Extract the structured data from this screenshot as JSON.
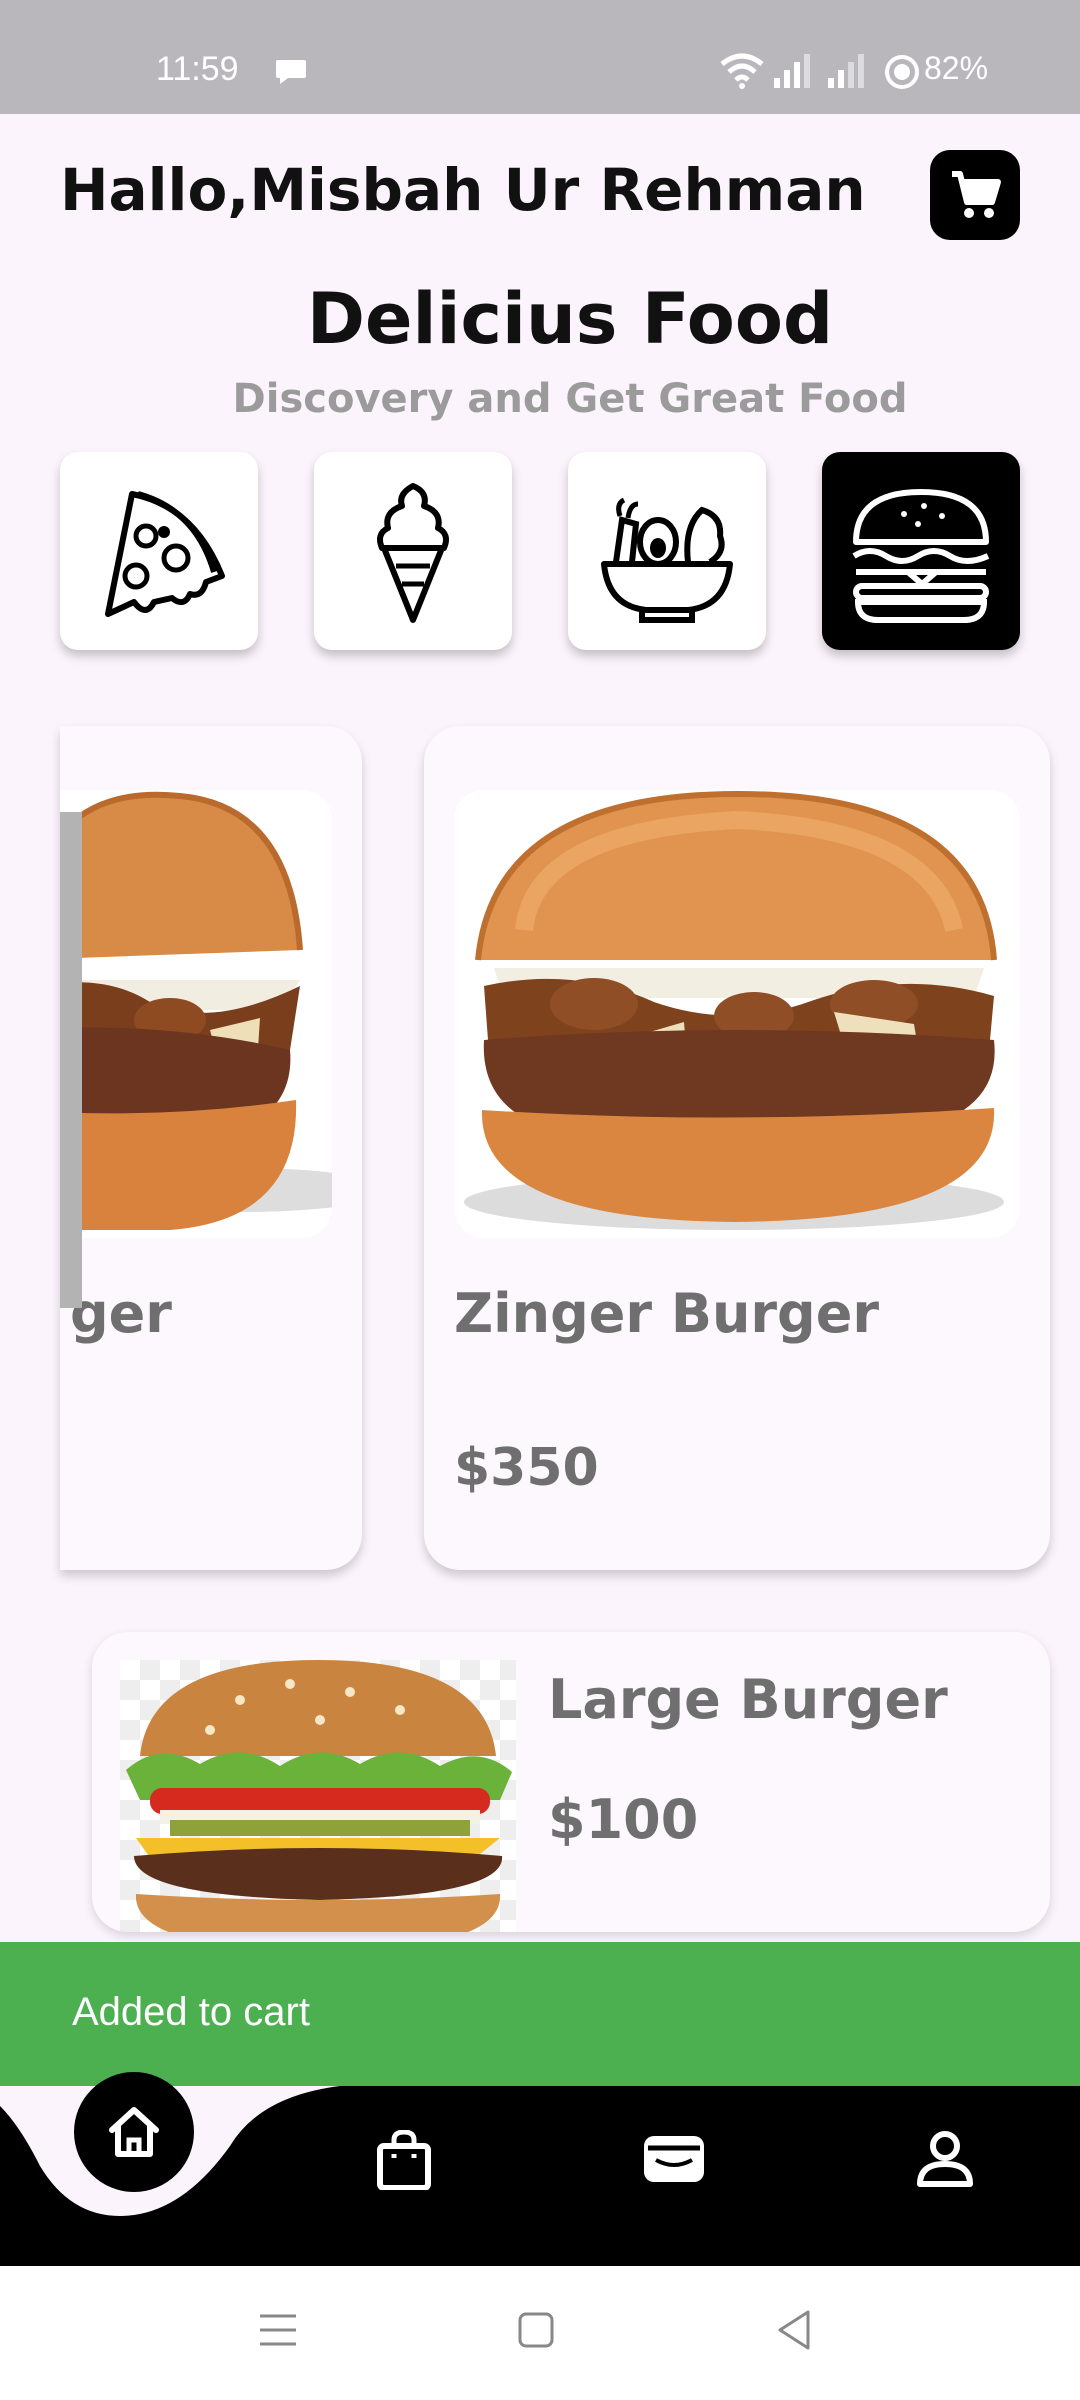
{
  "status_bar": {
    "time": "11:59",
    "battery": "82%"
  },
  "header": {
    "greeting": "Hallo,Misbah Ur Rehman"
  },
  "hero": {
    "title": "Delicius Food",
    "subtitle": "Discovery and Get Great Food"
  },
  "categories": [
    {
      "icon": "pizza-icon",
      "selected": false
    },
    {
      "icon": "ice-cream-icon",
      "selected": false
    },
    {
      "icon": "salad-bowl-icon",
      "selected": false
    },
    {
      "icon": "burger-icon",
      "selected": true
    }
  ],
  "products": [
    {
      "name": "ger",
      "price": ""
    },
    {
      "name": "Zinger Burger",
      "price": "$350"
    }
  ],
  "list": [
    {
      "name": "Large Burger",
      "price": "$100"
    }
  ],
  "snackbar": {
    "message": "Added to cart"
  },
  "nav": {
    "items": [
      "home-icon",
      "shopping-bag-icon",
      "wallet-icon",
      "profile-icon"
    ],
    "active": 0
  },
  "colors": {
    "accent": "#000000",
    "snackbar": "#4CAF50",
    "background": "#FCF4FC"
  }
}
